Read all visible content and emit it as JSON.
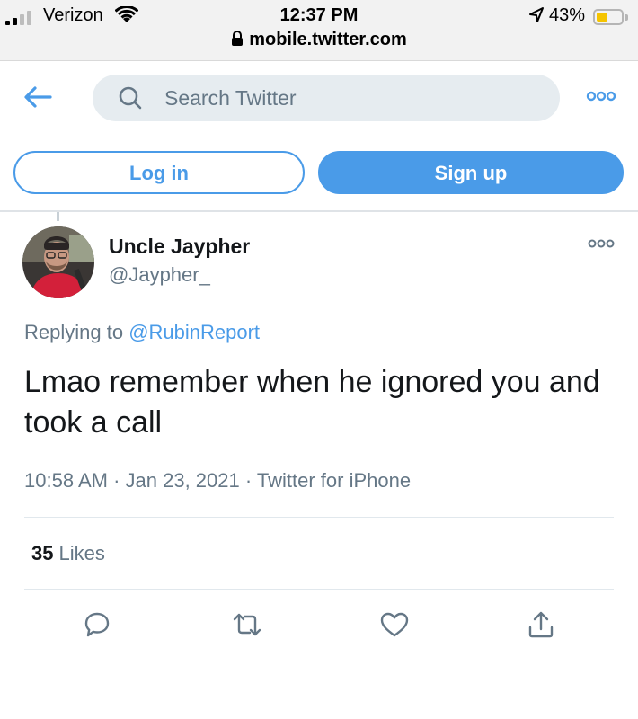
{
  "status_bar": {
    "carrier": "Verizon",
    "time": "12:37 PM",
    "battery_percent": "43%",
    "battery_level": 0.43,
    "url": "mobile.twitter.com"
  },
  "header": {
    "search_placeholder": "Search Twitter",
    "login_label": "Log in",
    "signup_label": "Sign up"
  },
  "tweet": {
    "display_name": "Uncle Jaypher",
    "handle": "@Jaypher_",
    "replying_prefix": "Replying to ",
    "replying_to": "@RubinReport",
    "text": "Lmao remember when he ignored you and took a call",
    "time": "10:58 AM",
    "sep1": " · ",
    "date": "Jan 23, 2021",
    "sep2": " · ",
    "source": "Twitter for iPhone",
    "likes_count": "35",
    "likes_label": "Likes"
  },
  "colors": {
    "accent": "#4a9be8",
    "secondary_text": "#657786",
    "battery": "#f5c400"
  },
  "icons": [
    "signal-icon",
    "wifi-icon",
    "location-icon",
    "battery-icon",
    "lock-icon",
    "back-arrow-icon",
    "search-icon",
    "more-icon",
    "reply-icon",
    "retweet-icon",
    "like-icon",
    "share-icon"
  ]
}
